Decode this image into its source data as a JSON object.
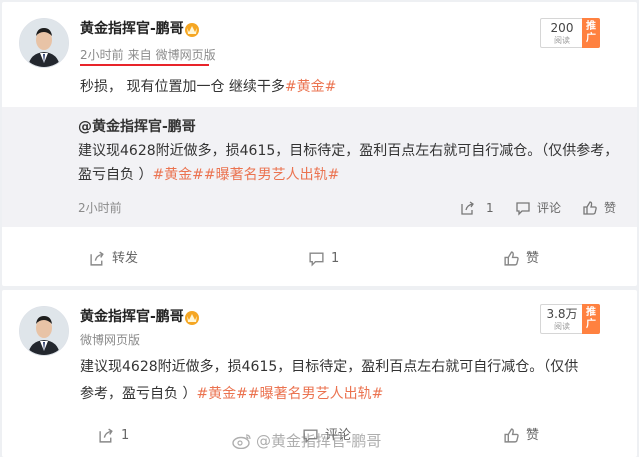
{
  "posts": [
    {
      "username": "黄金指挥官-鹏哥",
      "time": "2小时前",
      "source_prefix": "来自",
      "source": "微博网页版",
      "read_count": "200",
      "read_label": "阅读",
      "promo": "推广",
      "text_plain": "秒损， 现有位置加一仓 继续干多",
      "text_tag": "#黄金#",
      "repost": {
        "author": "@黄金指挥官-鹏哥",
        "line1": "建议现4628附近做多，损4615，目标待定，盈利百点左右就可自行减仓。（仅供参考，",
        "line2_plain": "盈亏自负 ）",
        "tag1": "#黄金#",
        "tag2": "#曝著名男艺人出轨#",
        "time": "2小时前",
        "forward_count": "1",
        "comment_label": "评论",
        "like_label": "赞"
      },
      "actions": {
        "forward": "转发",
        "comment": "1",
        "like": "赞"
      }
    },
    {
      "username": "黄金指挥官-鹏哥",
      "source": "微博网页版",
      "read_count": "3.8万",
      "read_label": "阅读",
      "promo": "推广",
      "line1": "建议现4628附近做多，损4615，目标待定，盈利百点左右就可自行减仓。（仅供",
      "line2_plain": "参考，盈亏自负 ）",
      "tag1": "#黄金#",
      "tag2": "#曝著名男艺人出轨#",
      "actions": {
        "forward": "1",
        "comment": "评论",
        "like": "赞"
      }
    }
  ],
  "watermark": "@黄金指挥官-鹏哥",
  "colors": {
    "tag": "#eb7350",
    "promo": "#ff8140",
    "underline": "#e8242a",
    "repost_bg": "#f2f2f5"
  }
}
